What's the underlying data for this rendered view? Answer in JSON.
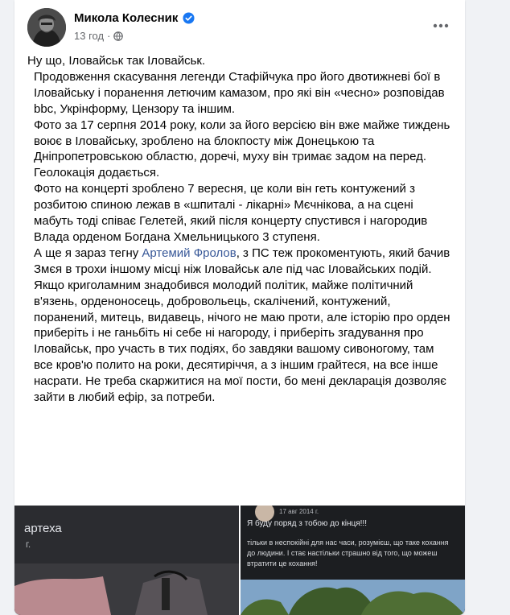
{
  "post": {
    "author": "Микола Колесник",
    "time": "13 год",
    "separator": "·"
  },
  "paragraphs": [
    "Ну що, Іловайськ так Іловайськ.",
    "Продовження скасування легенди Стафійчука про його двотижневі бої в Іловайську і поранення летючим камазом, про які він «чесно» розповідав bbc, Укрінформу, Цензору та іншим.",
    "Фото за 17 серпня 2014 року, коли за його версією він вже майже тиждень воює в Іловайську, зроблено на блокпосту між Донецькою та Дніпропетровською областю, доречі, муху він тримає задом на перед. Геолокація додається.",
    "Фото на концерті зроблено 7 вересня, це коли він геть контужений з розбитою спиною лежав в «шпиталі - лікарні» Мєчнікова, а на сцені мабуть тоді співає Гелетей, який після концерту спустився і нагородив Влада орденом Богдана Хмельницького 3 ступеня.",
    "Якщо криголамним знадобився молодий політик, майже політичний в'язень, орденоносець, добровольець, скалічений, контужений, поранений, митець, видавець, нічого не маю проти, але історію про орден приберіть і не ганьбіть ні себе ні нагороду, і приберіть згадування про Іловайськ, про участь в тих подіях, бо завдяки вашому сивоногому, там все кров'ю полито на роки, десятиріччя, а з іншим грайтеся, на все інше насрати. Не треба скаржитися на мої пости, бо мені декларація дозволяє зайти в любий ефір, за потреби."
  ],
  "mention_paragraph": {
    "before": "А ще я зараз тегну ",
    "link": "Артемий Фролов",
    "after": ", з ПС теж прокоментують, який бачив Змєя в трохи іншому місці ніж Іловайськ але під час Іловайських подій."
  },
  "photo_left": {
    "title": "артеха",
    "sub": "г."
  },
  "photo_right": {
    "date": "17 авг 2014 г.",
    "quote": "Я буду поряд з тобою до кінця!!!",
    "body": "тільки в неспокійні для нас часи, розумієш, що таке кохання до людини. І стає настільки страшно від того, що можеш втратити це кохання!"
  },
  "colors": {
    "link": "#385898",
    "verified": "#1877f2",
    "text": "#050505",
    "muted": "#65676b"
  },
  "icons": [
    "verified-icon",
    "globe-icon",
    "more-icon"
  ]
}
